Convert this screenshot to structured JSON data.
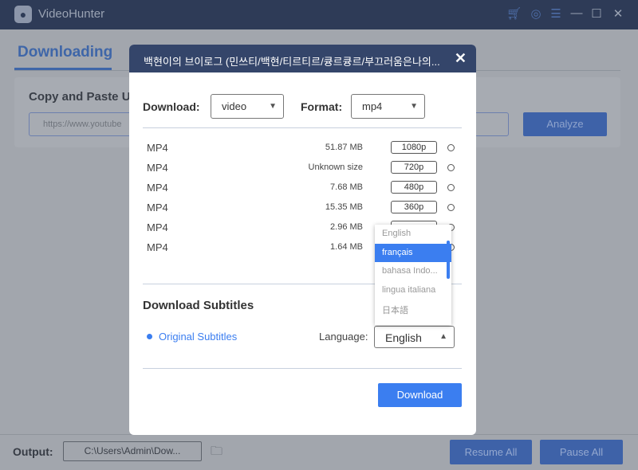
{
  "app": {
    "title": "VideoHunter",
    "tab": "Downloading",
    "card_title": "Copy and Paste U",
    "url_placeholder": "https://www.youtube",
    "analyze": "Analyze"
  },
  "bottom": {
    "output_label": "Output:",
    "output_path": "C:\\Users\\Admin\\Dow...",
    "resume_all": "Resume All",
    "pause_all": "Pause All"
  },
  "modal": {
    "title": "백현이의 브이로그 (민쓰티/백현/티르티르/큥르큥르/부끄러움은나의...",
    "download_label": "Download:",
    "download_value": "video",
    "format_label": "Format:",
    "format_value": "mp4",
    "rows": [
      {
        "format": "MP4",
        "size": "51.87 MB",
        "resolution": "1080p"
      },
      {
        "format": "MP4",
        "size": "Unknown size",
        "resolution": "720p"
      },
      {
        "format": "MP4",
        "size": "7.68 MB",
        "resolution": "480p"
      },
      {
        "format": "MP4",
        "size": "15.35 MB",
        "resolution": "360p"
      },
      {
        "format": "MP4",
        "size": "2.96 MB",
        "resolution": ""
      },
      {
        "format": "MP4",
        "size": "1.64 MB",
        "resolution": ""
      }
    ],
    "subtitles_heading": "Download Subtitles",
    "original_subtitles": "Original Subtitles",
    "language_label": "Language:",
    "language_value": "English",
    "language_options": [
      "English",
      "français",
      "bahasa Indo...",
      "lingua italiana",
      "日本語"
    ],
    "highlighted_option": "français",
    "download_button": "Download"
  },
  "colors": {
    "titlebar": "#2e3b57",
    "accent": "#3b7ef0",
    "modal_header": "#34456a"
  }
}
